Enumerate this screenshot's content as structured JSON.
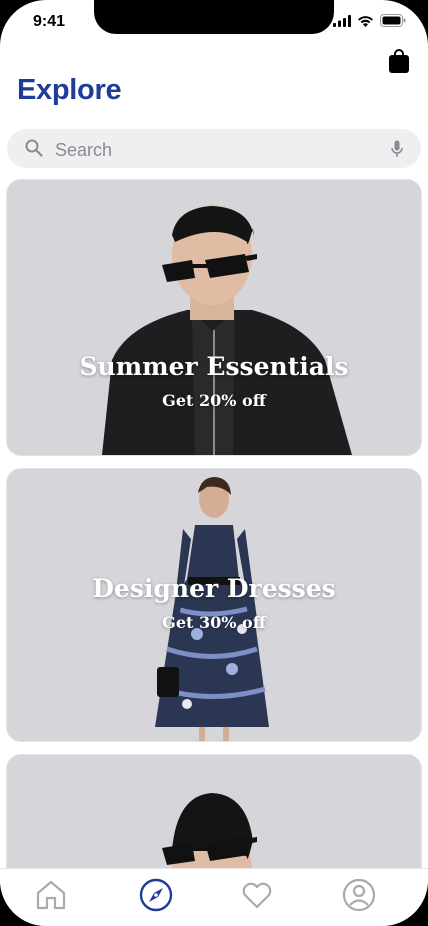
{
  "status_bar": {
    "time": "9:41"
  },
  "header": {
    "title": "Explore"
  },
  "search": {
    "placeholder": "Search"
  },
  "cards": [
    {
      "title": "Summer Essentials",
      "subtitle": "Get 20% off"
    },
    {
      "title": "Designer Dresses",
      "subtitle": "Get 30% off"
    },
    {
      "title": "",
      "subtitle": ""
    }
  ],
  "tabbar": {
    "items": [
      {
        "icon": "home-icon",
        "active": false
      },
      {
        "icon": "compass-icon",
        "active": true
      },
      {
        "icon": "heart-icon",
        "active": false
      },
      {
        "icon": "profile-icon",
        "active": false
      }
    ]
  },
  "colors": {
    "accent": "#1f3c97",
    "inactive_icon": "#a9a9ae",
    "search_bg": "#efeff1"
  }
}
